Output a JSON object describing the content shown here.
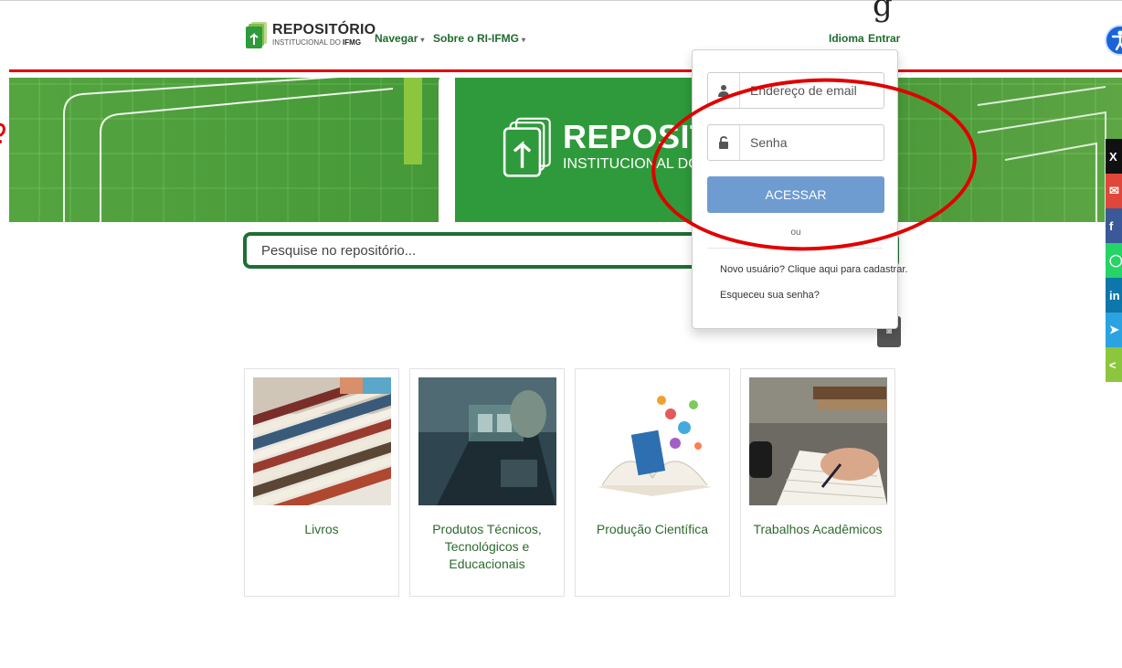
{
  "header": {
    "logo_title": "REPOSITÓRIO",
    "logo_subtitle_prefix": "INSTITUCIONAL DO ",
    "logo_subtitle_bold": "IFMG",
    "nav_browse": "Navegar",
    "nav_about": "Sobre o RI-IFMG",
    "language": "Idioma",
    "login": "Entrar",
    "top_fragment": "g"
  },
  "banner": {
    "title": "REPOSITÓRIO",
    "subtitle": "INSTITUCIONAL DO IFMG"
  },
  "search": {
    "placeholder": "Pesquise no repositório..."
  },
  "login_menu": {
    "email_placeholder": "Endereço de email",
    "password_placeholder": "Senha",
    "submit_label": "ACESSAR",
    "or_label": "ou",
    "register_link": "Novo usuário? Clique aqui para cadastrar.",
    "forgot_link": "Esqueceu sua senha?"
  },
  "categories": [
    {
      "label": "Livros"
    },
    {
      "label": "Produtos Técnicos, Tecnológicos e Educacionais"
    },
    {
      "label": "Produção Científica"
    },
    {
      "label": "Trabalhos Acadêmicos"
    }
  ],
  "share_buttons": [
    {
      "icon": "x-icon",
      "glyph": "X",
      "color": "#111111"
    },
    {
      "icon": "email-icon",
      "glyph": "✉",
      "color": "#e0473a"
    },
    {
      "icon": "facebook-icon",
      "glyph": "f",
      "color": "#3b5998"
    },
    {
      "icon": "whatsapp-icon",
      "glyph": "◯",
      "color": "#25d366"
    },
    {
      "icon": "linkedin-icon",
      "glyph": "in",
      "color": "#0e76a8"
    },
    {
      "icon": "telegram-icon",
      "glyph": "➤",
      "color": "#2aa3e0"
    },
    {
      "icon": "share-icon",
      "glyph": "<",
      "color": "#8cc63f"
    }
  ],
  "colors": {
    "brand_green": "#2f9a3b",
    "link_green": "#1f6b2e",
    "annotation_red": "#e00000",
    "login_button": "#6e9cd0"
  }
}
